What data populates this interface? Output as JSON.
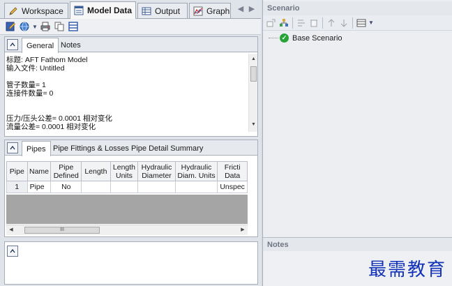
{
  "tabs": [
    {
      "label": "Workspace",
      "icon": "pencil-icon"
    },
    {
      "label": "Model Data",
      "icon": "model-data-icon"
    },
    {
      "label": "Output",
      "icon": "table-icon"
    },
    {
      "label": "Graph",
      "icon": "graph-icon"
    }
  ],
  "general_panel": {
    "tabs": [
      "General",
      "Notes"
    ],
    "lines": [
      "标题: AFT Fathom Model",
      "输入文件: Untitled",
      "",
      "管子数量= 1",
      "连接件数量= 0",
      "",
      "",
      "压力/压头公差= 0.0001 相对变化",
      "流量公差= 0.0001 相对变化"
    ]
  },
  "pipes_panel": {
    "tabs": [
      "Pipes",
      "Pipe Fittings & Losses",
      "Pipe Detail Summary"
    ],
    "columns": [
      {
        "l1": "Pipe",
        "l2": ""
      },
      {
        "l1": "Name",
        "l2": ""
      },
      {
        "l1": "Pipe",
        "l2": "Defined"
      },
      {
        "l1": "Length",
        "l2": ""
      },
      {
        "l1": "Length",
        "l2": "Units"
      },
      {
        "l1": "Hydraulic",
        "l2": "Diameter"
      },
      {
        "l1": "Hydraulic",
        "l2": "Diam. Units"
      },
      {
        "l1": "Fricti",
        "l2": "Data"
      }
    ],
    "rows": [
      [
        "1",
        "Pipe",
        "No",
        "",
        "",
        "",
        "",
        "Unspec"
      ]
    ],
    "scroll_thumb_text": "III"
  },
  "scenario": {
    "header": "Scenario",
    "items": [
      "Base Scenario"
    ]
  },
  "notes": {
    "header": "Notes"
  },
  "watermark": "最需教育",
  "colors": {
    "accent": "#1232b8",
    "scenario_check": "#27a437"
  }
}
